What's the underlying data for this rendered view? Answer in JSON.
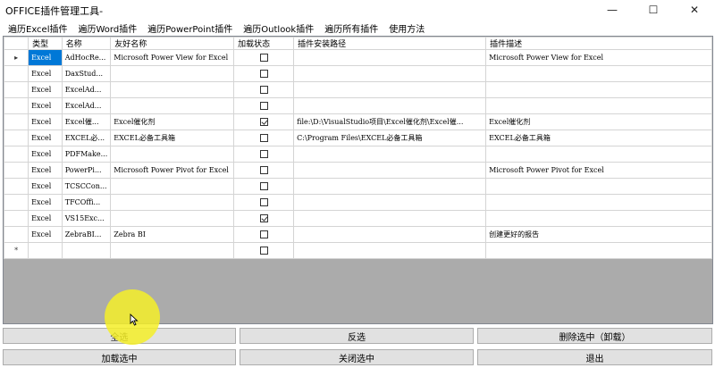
{
  "window": {
    "title": "OFFICE插件管理工具-",
    "controls": {
      "minimize": "—",
      "maximize": "☐",
      "close": "✕"
    }
  },
  "menu": [
    "遍历Excel插件",
    "遍历Word插件",
    "遍历PowerPoint插件",
    "遍历Outlook插件",
    "遍历所有插件",
    "使用方法"
  ],
  "grid": {
    "columns": [
      "类型",
      "名称",
      "友好名称",
      "加载状态",
      "插件安装路径",
      "插件描述"
    ],
    "current_row_marker": "▸",
    "new_row_marker": "*",
    "rows": [
      {
        "type": "Excel",
        "name": "AdHocRe...",
        "friendly": "Microsoft Power View for Excel",
        "loaded": false,
        "path": "",
        "desc": "Microsoft Power View for Excel"
      },
      {
        "type": "Excel",
        "name": "DaxStud...",
        "friendly": "",
        "loaded": false,
        "path": "",
        "desc": ""
      },
      {
        "type": "Excel",
        "name": "ExcelAd...",
        "friendly": "",
        "loaded": false,
        "path": "",
        "desc": ""
      },
      {
        "type": "Excel",
        "name": "ExcelAd...",
        "friendly": "",
        "loaded": false,
        "path": "",
        "desc": ""
      },
      {
        "type": "Excel",
        "name": "Excel催...",
        "friendly": "Excel催化剂",
        "loaded": true,
        "path": "file:\\D:\\VisualStudio项目\\Excel催化剂\\Excel催...",
        "desc": "Excel催化剂"
      },
      {
        "type": "Excel",
        "name": "EXCEL必...",
        "friendly": "EXCEL必备工具箱",
        "loaded": false,
        "path": "C:\\Program Files\\EXCEL必备工具箱",
        "desc": "EXCEL必备工具箱"
      },
      {
        "type": "Excel",
        "name": "PDFMake...",
        "friendly": "",
        "loaded": false,
        "path": "",
        "desc": ""
      },
      {
        "type": "Excel",
        "name": "PowerPi...",
        "friendly": "Microsoft Power Pivot for Excel",
        "loaded": false,
        "path": "",
        "desc": "Microsoft Power Pivot for Excel"
      },
      {
        "type": "Excel",
        "name": "TCSCCon...",
        "friendly": "",
        "loaded": false,
        "path": "",
        "desc": ""
      },
      {
        "type": "Excel",
        "name": "TFCOffi...",
        "friendly": "",
        "loaded": false,
        "path": "",
        "desc": ""
      },
      {
        "type": "Excel",
        "name": "VS15Exc...",
        "friendly": "",
        "loaded": true,
        "path": "",
        "desc": ""
      },
      {
        "type": "Excel",
        "name": "ZebraBI...",
        "friendly": "Zebra BI",
        "loaded": false,
        "path": "",
        "desc": "创建更好的报告"
      }
    ]
  },
  "buttons": {
    "select_all": "全选",
    "invert": "反选",
    "delete_selected": "删除选中（卸载）",
    "load_selected": "加载选中",
    "close_selected": "关闭选中",
    "exit": "退出"
  }
}
